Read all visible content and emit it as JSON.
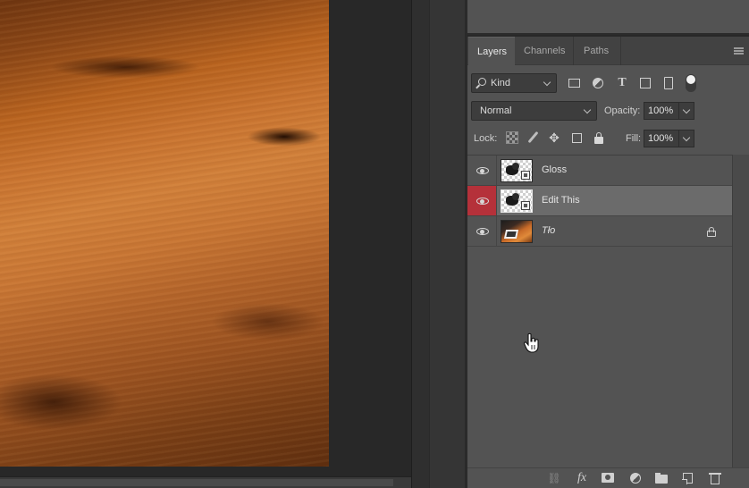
{
  "layers_panel": {
    "tabs": [
      {
        "label": "Layers",
        "active": true
      },
      {
        "label": "Channels",
        "active": false
      },
      {
        "label": "Paths",
        "active": false
      }
    ],
    "filter": {
      "kind_label": "Kind",
      "icons": [
        "pixel-filter-icon",
        "adjustment-filter-icon",
        "type-filter-icon",
        "shape-filter-icon",
        "smart-object-filter-icon"
      ]
    },
    "blend_mode": "Normal",
    "opacity_label": "Opacity:",
    "opacity_value": "100%",
    "lock_label": "Lock:",
    "fill_label": "Fill:",
    "fill_value": "100%",
    "layers": [
      {
        "name": "Gloss",
        "visible": true,
        "selected": false,
        "locked": false
      },
      {
        "name": "Edit This",
        "visible": true,
        "selected": true,
        "locked": false
      },
      {
        "name": "Tło",
        "visible": true,
        "selected": false,
        "locked": true
      }
    ],
    "footer_icons": [
      "link-icon",
      "fx-icon",
      "mask-icon",
      "adjustment-icon",
      "group-folder-icon",
      "new-layer-icon",
      "trash-icon"
    ]
  },
  "colors": {
    "panel_bg": "#535353",
    "selected_row": "#6b6b6b",
    "visibility_highlight": "#b5313a",
    "canvas_bg": "#282828"
  }
}
